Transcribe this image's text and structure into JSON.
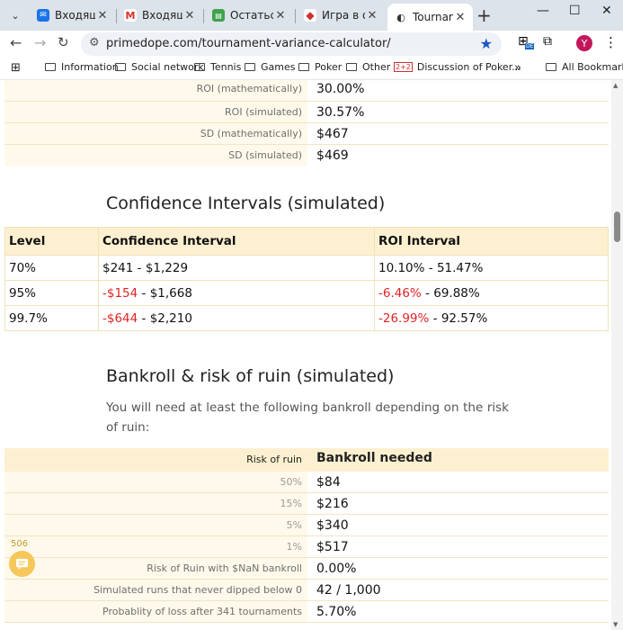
{
  "browser": {
    "tabs": [
      {
        "title": "Входящие"
      },
      {
        "title": "Входящие"
      },
      {
        "title": "Остаться в"
      },
      {
        "title": "Игра в онл"
      },
      {
        "title": "Tournament"
      }
    ],
    "url": "primedope.com/tournament-variance-calculator/",
    "avatar": "Y",
    "ext_badge": "DE",
    "bookmarks": [
      {
        "label": "Information"
      },
      {
        "label": "Social network"
      },
      {
        "label": "Tennis"
      },
      {
        "label": "Games"
      },
      {
        "label": "Poker"
      },
      {
        "label": "Other"
      },
      {
        "label": "Discussion of Poker..."
      }
    ],
    "more_bookmarks": "»",
    "all_bookmarks": "All Bookmarks"
  },
  "stats_rows": [
    {
      "label": "ROI (mathematically)",
      "value": "30.00%"
    },
    {
      "label": "ROI (simulated)",
      "value": "30.57%"
    },
    {
      "label": "SD (mathematically)",
      "value": "$467"
    },
    {
      "label": "SD (simulated)",
      "value": "$469"
    }
  ],
  "confidence": {
    "heading": "Confidence Intervals (simulated)",
    "headers": [
      "Level",
      "Confidence Interval",
      "ROI Interval"
    ],
    "rows": [
      {
        "level": "70%",
        "ci_low": "$241",
        "ci_high": "$1,229",
        "roi_low": "10.10%",
        "roi_high": "51.47%",
        "neg": false
      },
      {
        "level": "95%",
        "ci_low": "-$154",
        "ci_high": "$1,668",
        "roi_low": "-6.46%",
        "roi_high": "69.88%",
        "neg": true
      },
      {
        "level": "99.7%",
        "ci_low": "-$644",
        "ci_high": "$2,210",
        "roi_low": "-26.99%",
        "roi_high": "92.57%",
        "neg": true
      }
    ]
  },
  "bankroll": {
    "heading": "Bankroll & risk of ruin (simulated)",
    "intro": "You will need at least the following bankroll depending on the risk of ruin:",
    "header_label": "Risk of ruin",
    "header_value": "Bankroll needed",
    "rows": [
      {
        "label": "50%",
        "value": "$84"
      },
      {
        "label": "15%",
        "value": "$216"
      },
      {
        "label": "5%",
        "value": "$340"
      },
      {
        "label": "1%",
        "value": "$517"
      },
      {
        "label": "Risk of Ruin with $NaN bankroll",
        "value": "0.00%"
      },
      {
        "label": "Simulated runs that never dipped below 0",
        "value": "42 / 1,000"
      },
      {
        "label": "Probablity of loss after 341 tournaments",
        "value": "5.70%"
      }
    ]
  },
  "chat_badge": "506",
  "colors": {
    "accent_row": "#fdf0d0",
    "negative": "#e02424",
    "chat": "#f6c75a"
  }
}
